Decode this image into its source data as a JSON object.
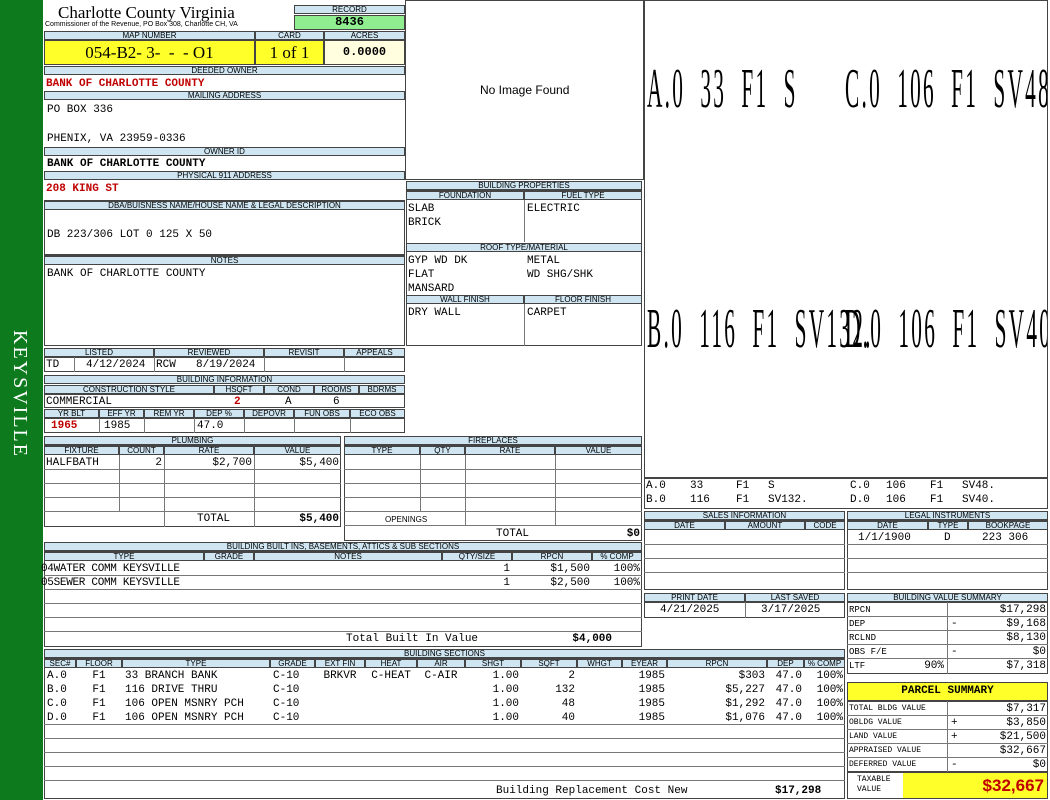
{
  "sidebar": {
    "label": "KEYSVILLE"
  },
  "header": {
    "county": "Charlotte County Virginia",
    "commissioner": "Commissioner of the Revenue, PO Box 308, Charlotte CH, VA",
    "record_label": "RECORD",
    "record": "8436",
    "map_label": "MAP NUMBER",
    "map": "054-B2- 3-  -  - O1",
    "card_label": "CARD",
    "card": "1 of 1",
    "acres_label": "ACRES",
    "acres": "0.0000"
  },
  "owner": {
    "deeded_label": "DEEDED OWNER",
    "deeded": "BANK OF CHARLOTTE COUNTY",
    "mailing_label": "MAILING ADDRESS",
    "addr1": "PO BOX 336",
    "addr2": "PHENIX, VA 23959-0336",
    "owner_id_label": "OWNER ID",
    "owner_id": "BANK OF CHARLOTTE COUNTY",
    "physical_label": "PHYSICAL 911 ADDRESS",
    "physical": "208 KING ST",
    "dba_label": "DBA/BUISNESS NAME/HOUSE NAME & LEGAL DESCRIPTION",
    "dba": "DB 223/306 LOT 0 125 X 50",
    "notes_label": "NOTES",
    "notes": "BANK OF CHARLOTTE COUNTY"
  },
  "image": {
    "text": "No Image Found"
  },
  "bprops": {
    "title": "BUILDING PROPERTIES",
    "foundation_label": "FOUNDATION",
    "fuel_label": "FUEL TYPE",
    "foundation": [
      "SLAB",
      "BRICK"
    ],
    "fuel": "ELECTRIC",
    "roof_label": "ROOF TYPE/MATERIAL",
    "roof_left": [
      "GYP WD DK",
      "FLAT",
      "MANSARD"
    ],
    "roof_right": [
      "METAL",
      "WD SHG/SHK"
    ],
    "wall_label": "WALL FINISH",
    "floor_label": "FLOOR FINISH",
    "wall": "DRY WALL",
    "floor": "CARPET"
  },
  "sketch": {
    "labels": [
      "A.0  33  F1  S",
      "C.0  106  F1  SV48.",
      "B.0  116  F1  SV132.",
      "D.0  106  F1  SV40."
    ],
    "legend": [
      {
        "code": "A.0",
        "area": "33",
        "floor": "F1",
        "sv": "S"
      },
      {
        "code": "C.0",
        "area": "106",
        "floor": "F1",
        "sv": "SV48."
      },
      {
        "code": "B.0",
        "area": "116",
        "floor": "F1",
        "sv": "SV132."
      },
      {
        "code": "D.0",
        "area": "106",
        "floor": "F1",
        "sv": "SV40."
      }
    ]
  },
  "listing": {
    "listed_label": "LISTED",
    "reviewed_label": "REVIEWED",
    "revisit_label": "REVISIT",
    "appeals_label": "APPEALS",
    "listed_by": "TD",
    "listed": "4/12/2024",
    "reviewed_by": "RCW",
    "reviewed": "8/19/2024"
  },
  "binfo": {
    "title": "BUILDING INFORMATION",
    "style_label": "CONSTRUCTION STYLE",
    "hsqft_label": "HSQFT",
    "cond_label": "COND",
    "rooms_label": "ROOMS",
    "bdrms_label": "BDRMS",
    "style": "COMMERCIAL",
    "hsqft": "2",
    "cond": "A",
    "rooms": "6",
    "yrblt_label": "YR BLT",
    "effyr_label": "EFF YR",
    "remyr_label": "REM YR",
    "dep_label": "DEP %",
    "depovr_label": "DEPOVR",
    "funobs_label": "FUN OBS",
    "ecoobs_label": "ECO OBS",
    "yrblt": "1965",
    "effyr": "1985",
    "dep": "47.0"
  },
  "plumbing": {
    "title": "PLUMBING",
    "headers": [
      "FIXTURE",
      "COUNT",
      "RATE",
      "VALUE"
    ],
    "rows": [
      {
        "fixture": "HALFBATH",
        "count": "2",
        "rate": "$2,700",
        "value": "$5,400"
      }
    ],
    "total_label": "TOTAL",
    "total": "$5,400"
  },
  "fireplaces": {
    "title": "FIREPLACES",
    "headers": [
      "TYPE",
      "QTY",
      "RATE",
      "VALUE"
    ],
    "openings_label": "OPENINGS",
    "total_label": "TOTAL",
    "total": "$0"
  },
  "builtins": {
    "title": "BUILDING BUILT INS, BASEMENTS, ATTICS & SUB SECTIONS",
    "headers": [
      "TYPE",
      "GRADE",
      "NOTES",
      "QTY/SIZE",
      "RPCN",
      "% COMP"
    ],
    "rows": [
      {
        "type": "04WATER COMM KEYSVILLE",
        "qty": "1",
        "rpcn": "$1,500",
        "comp": "100%"
      },
      {
        "type": "05SEWER COMM KEYSVILLE",
        "qty": "1",
        "rpcn": "$2,500",
        "comp": "100%"
      }
    ],
    "total_label": "Total Built In Value",
    "total": "$4,000"
  },
  "sales": {
    "title": "SALES INFORMATION",
    "headers": [
      "DATE",
      "AMOUNT",
      "CODE"
    ]
  },
  "legal": {
    "title": "LEGAL INSTRUMENTS",
    "headers": [
      "DATE",
      "TYPE",
      "BOOKPAGE"
    ],
    "rows": [
      {
        "date": "1/1/1900",
        "type": "D",
        "book": "223 306"
      }
    ]
  },
  "dates": {
    "print_label": "PRINT DATE",
    "saved_label": "LAST SAVED",
    "print": "4/21/2025",
    "saved": "3/17/2025"
  },
  "bvs": {
    "title": "BUILDING VALUE SUMMARY",
    "rows": [
      {
        "label": "RPCN",
        "sign": "",
        "pct": "",
        "value": "$17,298"
      },
      {
        "label": "DEP",
        "sign": "-",
        "pct": "",
        "value": "$9,168"
      },
      {
        "label": "RCLND",
        "sign": "",
        "pct": "",
        "value": "$8,130"
      },
      {
        "label": "OBS F/E",
        "sign": "-",
        "pct": "",
        "value": "$0"
      },
      {
        "label": "LTF",
        "sign": "",
        "pct": "90%",
        "value": "$7,318"
      }
    ]
  },
  "parcel": {
    "title": "PARCEL SUMMARY",
    "rows": [
      {
        "label": "TOTAL BLDG VALUE",
        "sign": "",
        "value": "$7,317"
      },
      {
        "label": "OBLDG VALUE",
        "sign": "+",
        "value": "$3,850"
      },
      {
        "label": "LAND VALUE",
        "sign": "+",
        "value": "$21,500"
      },
      {
        "label": "APPRAISED VALUE",
        "sign": "",
        "value": "$32,667"
      },
      {
        "label": "DEFERRED VALUE",
        "sign": "-",
        "value": "$0"
      }
    ],
    "taxable_label1": "TAXABLE",
    "taxable_label2": "VALUE",
    "taxable": "$32,667"
  },
  "sections": {
    "title": "BUILDING SECTIONS",
    "headers": [
      "SEC#",
      "FLOOR",
      "TYPE",
      "GRADE",
      "EXT FIN",
      "HEAT",
      "AIR",
      "SHGT",
      "SQFT",
      "WHGT",
      "EYEAR",
      "RPCN",
      "DEP",
      "% COMP"
    ],
    "rows": [
      {
        "sec": "A.0",
        "floor": "F1",
        "type": "33 BRANCH BANK",
        "grade": "C-10",
        "ext": "BRKVR",
        "heat": "C-HEAT",
        "air": "C-AIR",
        "shgt": "1.00",
        "sqft": "2",
        "eyear": "1985",
        "rpcn": "$303",
        "dep": "47.0",
        "comp": "100%"
      },
      {
        "sec": "B.0",
        "floor": "F1",
        "type": "116 DRIVE THRU",
        "grade": "C-10",
        "ext": "",
        "heat": "",
        "air": "",
        "shgt": "1.00",
        "sqft": "132",
        "eyear": "1985",
        "rpcn": "$5,227",
        "dep": "47.0",
        "comp": "100%"
      },
      {
        "sec": "C.0",
        "floor": "F1",
        "type": "106 OPEN MSNRY PCH",
        "grade": "C-10",
        "ext": "",
        "heat": "",
        "air": "",
        "shgt": "1.00",
        "sqft": "48",
        "eyear": "1985",
        "rpcn": "$1,292",
        "dep": "47.0",
        "comp": "100%"
      },
      {
        "sec": "D.0",
        "floor": "F1",
        "type": "106 OPEN MSNRY PCH",
        "grade": "C-10",
        "ext": "",
        "heat": "",
        "air": "",
        "shgt": "1.00",
        "sqft": "40",
        "eyear": "1985",
        "rpcn": "$1,076",
        "dep": "47.0",
        "comp": "100%"
      }
    ],
    "total_label": "Building Replacement Cost New",
    "total": "$17,298"
  },
  "colors": {
    "green": "#0e7a1e",
    "header_blue": "#cfe6f2",
    "yellow": "#ffff2a",
    "record_green": "#90ee90",
    "red": "#c00000"
  }
}
